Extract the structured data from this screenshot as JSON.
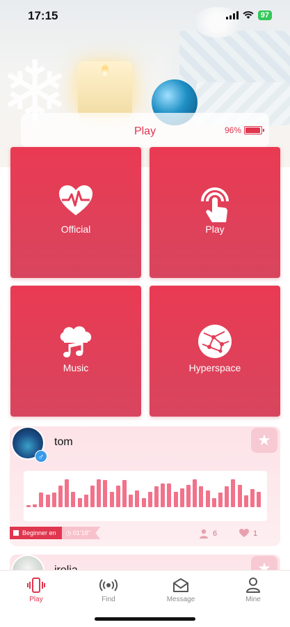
{
  "status_bar": {
    "time": "17:15",
    "battery": "97"
  },
  "header": {
    "title": "Play",
    "battery_percent": "96%",
    "battery_level": 0.96
  },
  "tiles": [
    {
      "label": "Official",
      "icon": "heart-pulse-icon"
    },
    {
      "label": "Play",
      "icon": "touch-icon"
    },
    {
      "label": "Music",
      "icon": "music-cloud-icon"
    },
    {
      "label": "Hyperspace",
      "icon": "globe-network-icon"
    }
  ],
  "feed": [
    {
      "username": "tom",
      "gender": "♂",
      "level": "Beginner en",
      "duration": "01'18''",
      "followers": "6",
      "likes": "1",
      "waveform": [
        0.06,
        0.1,
        0.48,
        0.4,
        0.48,
        0.7,
        0.9,
        0.5,
        0.3,
        0.4,
        0.7,
        0.9,
        0.88,
        0.5,
        0.7,
        0.88,
        0.4,
        0.55,
        0.3,
        0.5,
        0.68,
        0.78,
        0.78,
        0.5,
        0.62,
        0.72,
        0.9,
        0.68,
        0.55,
        0.3,
        0.48,
        0.68,
        0.9,
        0.72,
        0.38,
        0.6,
        0.5
      ]
    },
    {
      "username": "irelia"
    }
  ],
  "tab_bar": {
    "play": "Play",
    "find": "Find",
    "message": "Message",
    "mine": "Mine"
  },
  "colors": {
    "accent": "#e0364f",
    "tile": "#e33d56",
    "card_bg": "#fde6ea"
  }
}
